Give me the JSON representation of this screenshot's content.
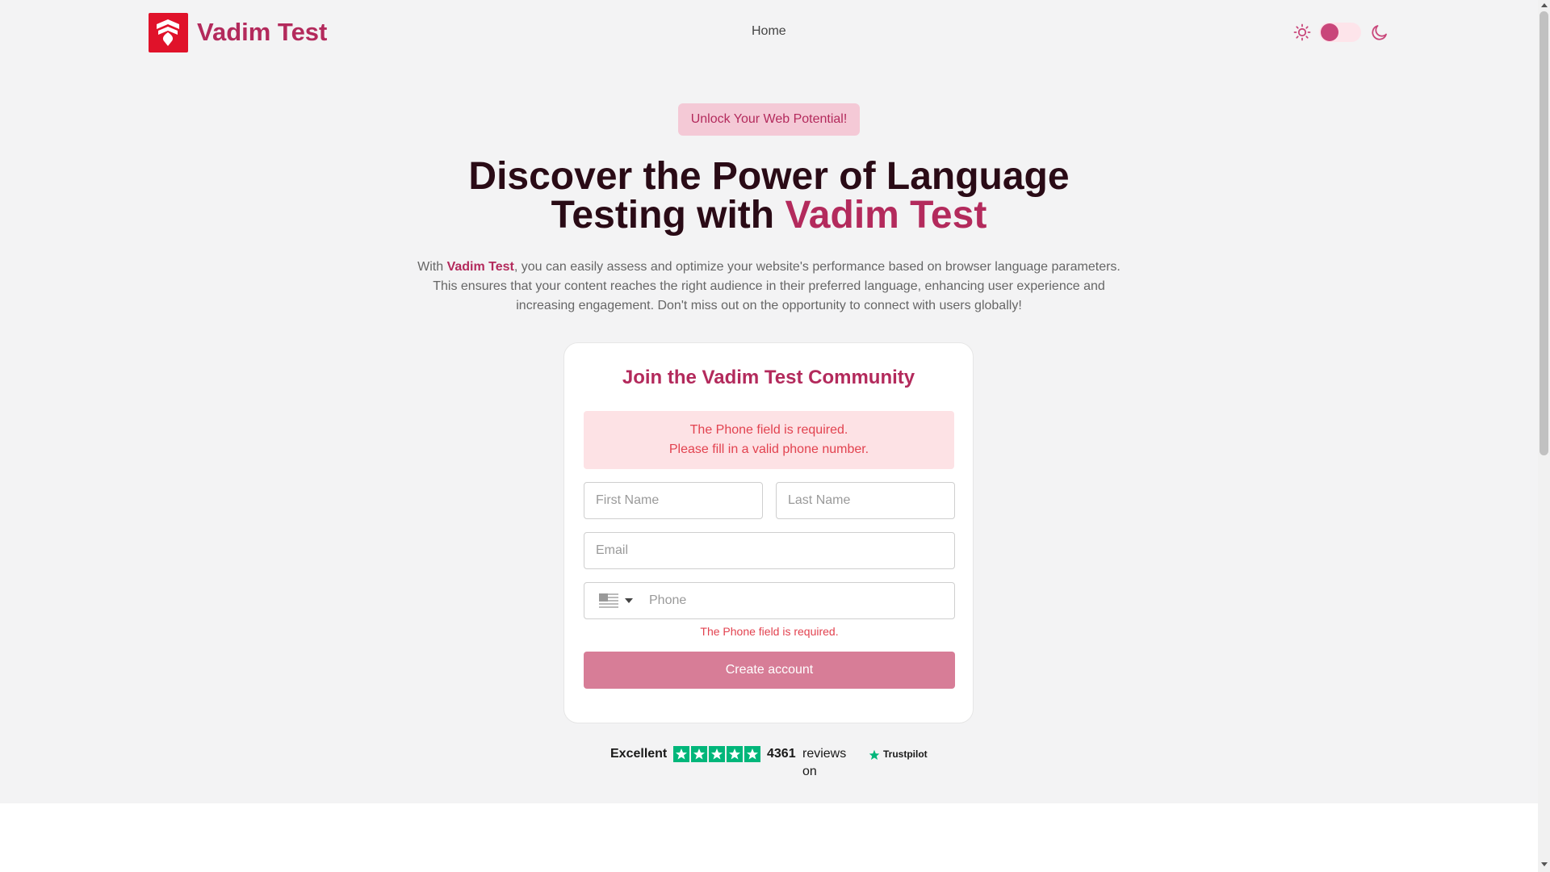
{
  "header": {
    "brand": "Vadim Test",
    "nav": [
      {
        "label": "Home"
      }
    ],
    "theme": {
      "light_icon": "sun-icon",
      "dark_icon": "moon-icon",
      "accent": "#c9467a"
    }
  },
  "hero": {
    "badge": "Unlock Your Web Potential!",
    "headline_line1": "Discover the Power of Language",
    "headline_line2_prefix": "Testing with ",
    "headline_accent": "Vadim Test",
    "lead_prefix": "With ",
    "lead_brand": "Vadim Test",
    "lead_text": ", you can easily assess and optimize your website's performance based on browser language parameters. This ensures that your content reaches the right audience in their preferred language, enhancing user experience and increasing engagement. Don't miss out on the opportunity to connect with users globally!"
  },
  "form": {
    "title": "Join the Vadim Test Community",
    "alert_line1": "The Phone field is required.",
    "alert_line2": "Please fill in a valid phone number.",
    "first_name": {
      "value": "",
      "placeholder": "First Name"
    },
    "last_name": {
      "value": "",
      "placeholder": "Last Name"
    },
    "email": {
      "value": "",
      "placeholder": "Email"
    },
    "phone": {
      "value": "",
      "placeholder": "Phone",
      "country_icon": "us-flag-icon"
    },
    "phone_error": "The Phone field is required.",
    "submit_label": "Create account"
  },
  "trustpilot": {
    "rating_label": "Excellent",
    "stars": 5,
    "count": "4361",
    "text": "reviews on",
    "brand": "Trustpilot"
  },
  "colors": {
    "brand": "#b32a5c",
    "logo_bg": "#e0122a",
    "error": "#e2424f",
    "button": "#d77d97",
    "trustpilot_green": "#00b67a"
  }
}
